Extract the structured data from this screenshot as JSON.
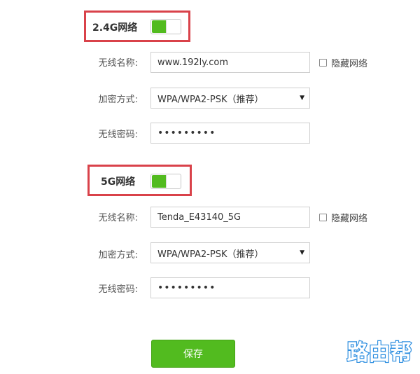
{
  "band24": {
    "title": "2.4G网络",
    "enabled": true,
    "ssid_label": "无线名称:",
    "ssid_value": "www.192ly.com",
    "hide_label": "隐藏网络",
    "encryption_label": "加密方式:",
    "encryption_value": "WPA/WPA2-PSK（推荐）",
    "password_label": "无线密码:",
    "password_value": "•••••••••"
  },
  "band5": {
    "title": "5G网络",
    "enabled": true,
    "ssid_label": "无线名称:",
    "ssid_value": "Tenda_E43140_5G",
    "hide_label": "隐藏网络",
    "encryption_label": "加密方式:",
    "encryption_value": "WPA/WPA2-PSK（推荐）",
    "password_label": "无线密码:",
    "password_value": "•••••••••"
  },
  "actions": {
    "save_label": "保存"
  },
  "watermark": {
    "text": "路由帮"
  },
  "colors": {
    "accent": "#52bb1f",
    "highlight_border": "#d9424a",
    "watermark_blue": "#2f8fe0"
  }
}
